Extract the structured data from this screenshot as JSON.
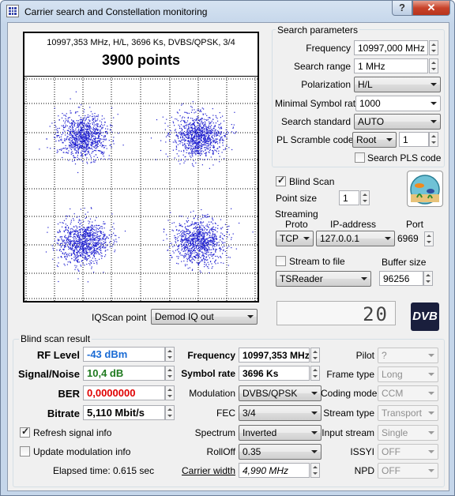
{
  "window": {
    "title": "Carrier search and Constellation monitoring",
    "help_label": "?",
    "close_label": "✕"
  },
  "plot": {
    "info": "10997,353 MHz, H/L, 3696 Ks, DVBS/QPSK, 3/4",
    "points": "3900 points",
    "dot_color": "#2020d0",
    "clusters": [
      {
        "x": -1,
        "y": 1
      },
      {
        "x": 1,
        "y": 1
      },
      {
        "x": -1,
        "y": -1
      },
      {
        "x": 1,
        "y": -1
      }
    ],
    "points_per_cluster": 975
  },
  "iqscan": {
    "label": "IQScan point",
    "value": "Demod IQ out"
  },
  "search": {
    "title": "Search parameters",
    "frequency_label": "Frequency",
    "frequency": "10997,000 MHz",
    "range_label": "Search range",
    "range": "1 MHz",
    "polarization_label": "Polarization",
    "polarization": "H/L",
    "msr_label": "Minimal Symbol rate",
    "msr": "1000",
    "standard_label": "Search standard",
    "standard": "AUTO",
    "pl_label": "PL Scramble code",
    "pl_mode": "Root",
    "pl_value": "1",
    "pls_label": "Search PLS code"
  },
  "blind": {
    "label": "Blind Scan",
    "point_size_label": "Point size",
    "point_size": "1"
  },
  "streaming": {
    "title": "Streaming",
    "proto_label": "Proto",
    "ip_label": "IP-address",
    "port_label": "Port",
    "proto": "TCP",
    "ip": "127.0.0.1",
    "port": "6969",
    "stream_to_file": "Stream to file",
    "buffer_label": "Buffer size",
    "reader": "TSReader",
    "buffer": "96256"
  },
  "lcd": "20",
  "logo": "DVB",
  "result": {
    "title": "Blind scan result",
    "rf_label": "RF Level",
    "rf": "-43 dBm",
    "rf_color": "#1a6bd4",
    "sn_label": "Signal/Noise",
    "sn": "10,4 dB",
    "sn_color": "#1f7a1f",
    "ber_label": "BER",
    "ber": "0,0000000",
    "ber_color": "#e00000",
    "bitrate_label": "Bitrate",
    "bitrate": "5,110 Mbit/s",
    "refresh_label": "Refresh signal info",
    "update_label": "Update modulation info",
    "elapsed": "Elapsed time: 0.615 sec",
    "freq_label": "Frequency",
    "freq": "10997,353 MHz",
    "sr_label": "Symbol rate",
    "sr": "3696 Ks",
    "mod_label": "Modulation",
    "mod": "DVBS/QPSK",
    "fec_label": "FEC",
    "fec": "3/4",
    "spectrum_label": "Spectrum",
    "spectrum": "Inverted",
    "rolloff_label": "RollOff",
    "rolloff": "0.35",
    "cw_label": "Carrier width",
    "cw": "4,990 MHz",
    "pilot_label": "Pilot",
    "pilot": "?",
    "frame_label": "Frame type",
    "frame": "Long",
    "coding_label": "Coding mode",
    "coding": "CCM",
    "stype_label": "Stream type",
    "stype": "Transport",
    "input_label": "Input stream",
    "input": "Single",
    "issyi_label": "ISSYI",
    "issyi": "OFF",
    "npd_label": "NPD",
    "npd": "OFF"
  }
}
